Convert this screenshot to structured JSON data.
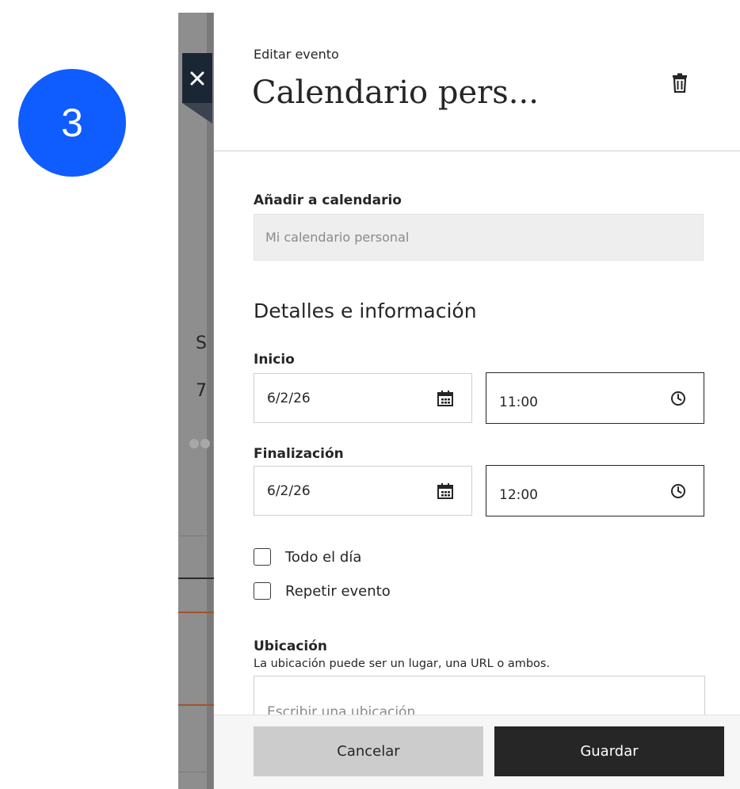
{
  "step_badge": "3",
  "background_page": {
    "letter_s": "S",
    "digit_7": "7"
  },
  "panel": {
    "kicker": "Editar evento",
    "title": "Calendario pers...",
    "add_to_calendar": {
      "label": "Añadir a calendario",
      "value": "Mi calendario personal"
    },
    "details_title": "Detalles e información",
    "start": {
      "label": "Inicio",
      "date": "6/2/26",
      "time": "11:00"
    },
    "end": {
      "label": "Finalización",
      "date": "6/2/26",
      "time": "12:00"
    },
    "all_day_label": "Todo el día",
    "repeat_label": "Repetir evento",
    "location": {
      "label": "Ubicación",
      "helper": "La ubicación puede ser un lugar, una URL o ambos.",
      "placeholder": "Escribir una ubicación"
    },
    "footer": {
      "cancel_label": "Cancelar",
      "save_label": "Guardar"
    }
  },
  "icons": {
    "close": "close-icon",
    "trash": "trash-icon",
    "calendar": "calendar-icon",
    "clock": "clock-icon"
  },
  "colors": {
    "badge": "#0f5cff",
    "close_tab": "#1b2635",
    "save_button": "#262626",
    "cancel_button": "#cccccc",
    "backdrop": "#8e8e8e"
  }
}
